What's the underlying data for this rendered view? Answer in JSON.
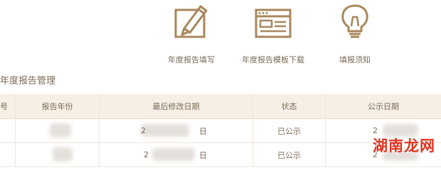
{
  "shortcuts": [
    {
      "label": "年度报告填写",
      "icon": "edit-pencil-icon"
    },
    {
      "label": "年度报告模板下载",
      "icon": "template-download-icon"
    },
    {
      "label": "填报须知",
      "icon": "lightbulb-icon"
    }
  ],
  "section_title": "年度报告管理",
  "table": {
    "headers": [
      "号",
      "报告年份",
      "最后修改日期",
      "状态",
      "公示日期"
    ],
    "rows": [
      {
        "modified": "2",
        "modified_tail": "日",
        "status": "已公示",
        "published": "2"
      },
      {
        "modified": "2",
        "modified_tail": "日",
        "status": "已公示",
        "published": "2"
      }
    ]
  },
  "watermark": "湖南龙网",
  "colors": {
    "accent": "#a8875c",
    "header_bg": "#f6efe6",
    "watermark": "#e0331f"
  }
}
